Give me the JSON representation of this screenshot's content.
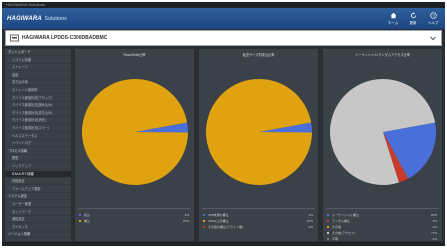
{
  "window_title": "HAGIWARA Solutions",
  "brand": {
    "name": "HAGIWARA",
    "suffix": "Solutions"
  },
  "header_buttons": [
    {
      "label": "ホーム",
      "icon": "home-icon"
    },
    {
      "label": "更新",
      "icon": "refresh-icon"
    },
    {
      "label": "ヘルプ",
      "icon": "help-icon"
    }
  ],
  "device": {
    "name": "HAGIWARA LPDDS-C300DBADBMC"
  },
  "sidebar": {
    "items": [
      {
        "label": "ダッシュボード",
        "level": 0
      },
      {
        "label": "システム情報",
        "level": 1
      },
      {
        "label": "ストレージ",
        "level": 1
      },
      {
        "label": "温度",
        "level": 1
      },
      {
        "label": "書き込み量",
        "level": 1
      },
      {
        "label": "ストレージ使用率",
        "level": 1
      },
      {
        "label": "デバイス使用状況(ブロック)",
        "level": 1
      },
      {
        "label": "デバイス使用状況(読み込み)",
        "level": 1
      },
      {
        "label": "デバイス使用状況(書き込み)",
        "level": 1
      },
      {
        "label": "デバイス使用状況(消去)",
        "level": 1
      },
      {
        "label": "デバイス使用状況(エラー)",
        "level": 1
      },
      {
        "label": "ヘルスステータス",
        "level": 1
      },
      {
        "label": "イベントログ",
        "level": 1
      },
      {
        "label": "プロセス情報",
        "level": 0
      },
      {
        "label": "履歴",
        "level": 1
      },
      {
        "label": "バックアップ",
        "level": 1
      },
      {
        "label": "S.M.A.R.T.情報",
        "level": 1,
        "active": true
      },
      {
        "label": "詳細設定",
        "level": 1
      },
      {
        "label": "ファームウェア更新",
        "level": 1
      },
      {
        "label": "システム設定",
        "level": 0
      },
      {
        "label": "ユーザー管理",
        "level": 1
      },
      {
        "label": "ネットワーク",
        "level": 1
      },
      {
        "label": "通知設定",
        "level": 1
      },
      {
        "label": "ライセンス",
        "level": 1
      },
      {
        "label": "バージョン情報",
        "level": 0
      }
    ]
  },
  "panels": [
    {
      "title": "Read/Write比率",
      "slices": [
        {
          "label": "Read",
          "value": 3,
          "color": "#4a6fd8"
        },
        {
          "label": "Write",
          "value": 97,
          "color": "#e0a20f"
        }
      ],
      "legend": [
        {
          "label": "読込",
          "value": "3%",
          "color": "#4a6fd8"
        },
        {
          "label": "書込",
          "value": "97%",
          "color": "#e0a20f"
        }
      ]
    },
    {
      "title": "転送サイズ別書込比率",
      "slices": [
        {
          "label": "< 4KB",
          "value": 3,
          "color": "#4a6fd8"
        },
        {
          "label": ">= 4KB",
          "value": 97,
          "color": "#e0a20f"
        },
        {
          "label": "Other",
          "value": 0,
          "color": "#c93a2a"
        }
      ],
      "legend": [
        {
          "label": "4KB未満の書込",
          "value": "3%",
          "color": "#4a6fd8"
        },
        {
          "label": "4KB以上の書込",
          "value": "97%",
          "color": "#e0a20f"
        },
        {
          "label": "その他の書込(アライン無)",
          "value": "0%",
          "color": "#c93a2a"
        }
      ]
    },
    {
      "title": "シーケンシャル/ランダムアクセス比率",
      "slices": [
        {
          "label": "Sequential",
          "value": 20,
          "color": "#4a6fd8"
        },
        {
          "label": "Random",
          "value": 3,
          "color": "#c93a2a"
        },
        {
          "label": "Other",
          "value": 77,
          "color": "#c7c7c7"
        }
      ],
      "legend": [
        {
          "label": "シーケンシャル書込",
          "value": "20%",
          "color": "#4a6fd8"
        },
        {
          "label": "ランダム書込",
          "value": "3%",
          "color": "#c93a2a"
        },
        {
          "label": "その他",
          "value": "0%",
          "color": "#e0a20f"
        },
        {
          "label": "その他(アクセス)",
          "value": "77%",
          "color": "#c7c7c7"
        },
        {
          "label": "不明",
          "value": "0%",
          "color": "#7a7a7a"
        }
      ]
    }
  ]
}
